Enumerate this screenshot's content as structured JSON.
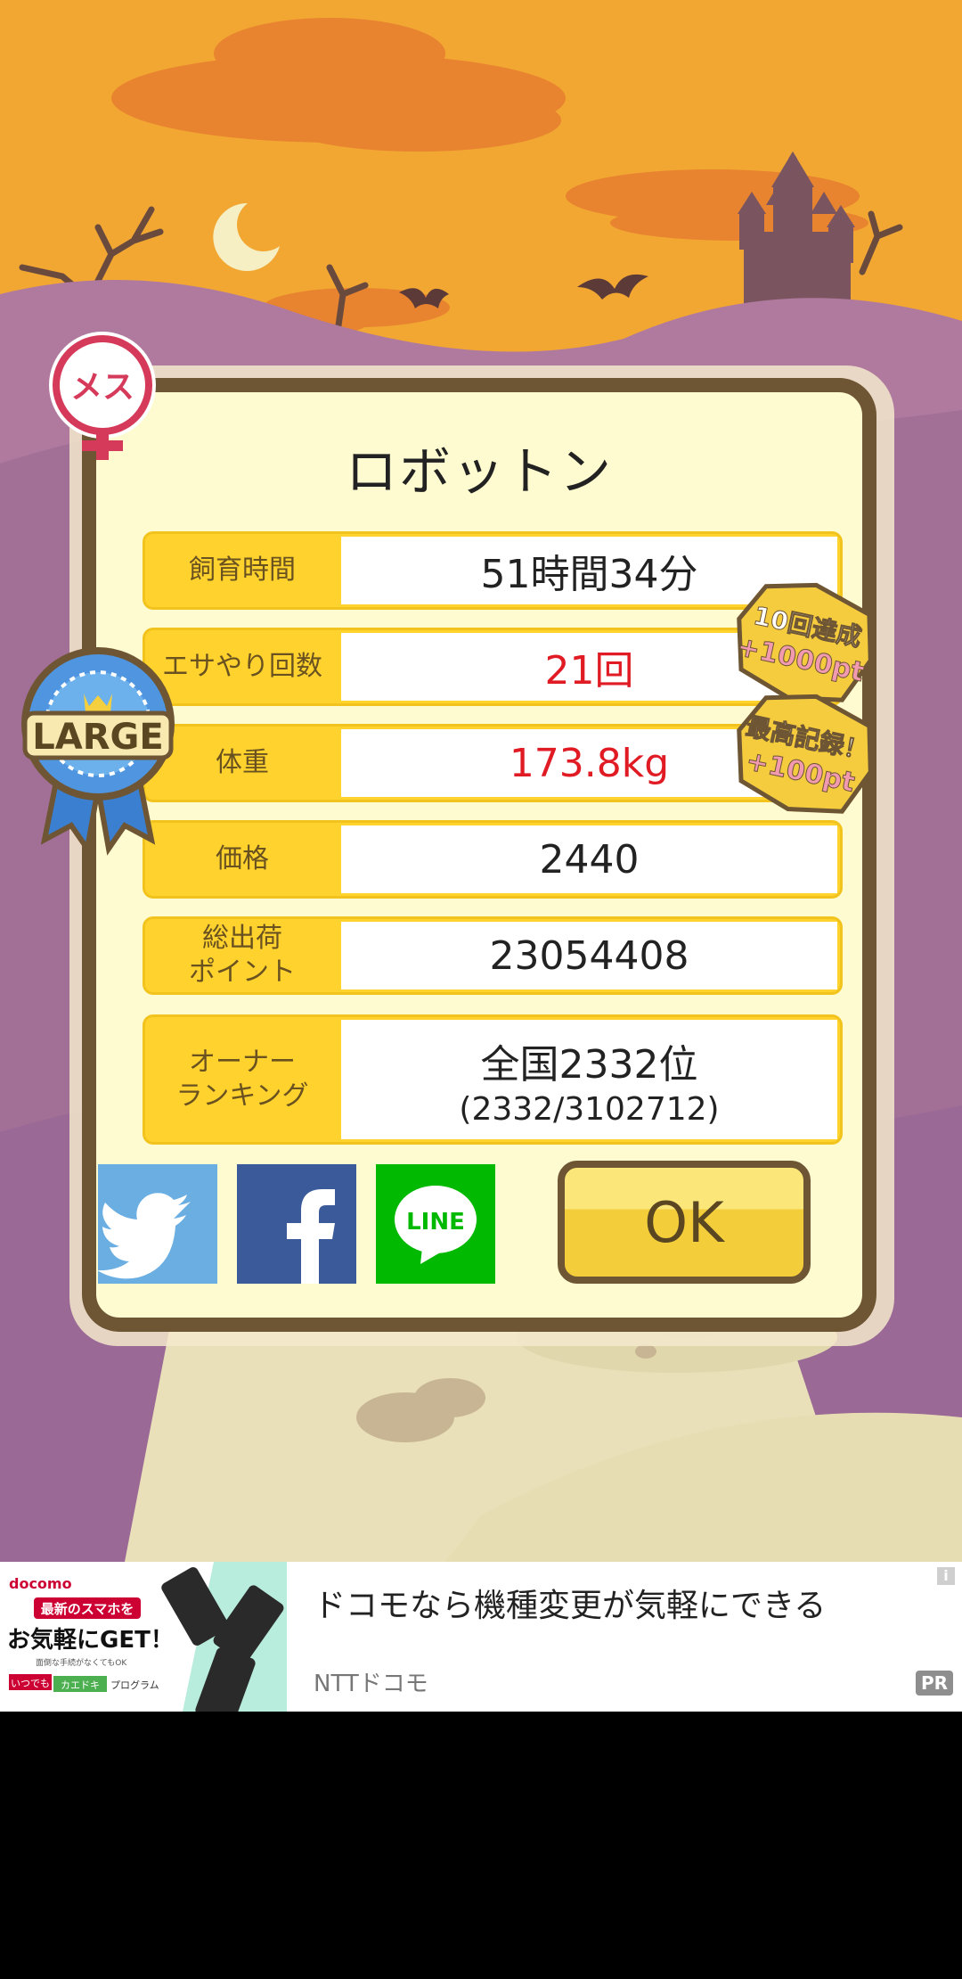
{
  "pet": {
    "name": "ロボットン",
    "gender_label": "メス",
    "size_badge": "LARGE"
  },
  "stats": [
    {
      "label": "飼育時間",
      "value": "51時間34分"
    },
    {
      "label": "エサやり回数",
      "value": "21回"
    },
    {
      "label": "体重",
      "value": "173.8kg"
    },
    {
      "label": "価格",
      "value": "2440"
    },
    {
      "label": "総出荷\nポイント",
      "value": "23054408"
    },
    {
      "label": "オーナー\nランキング",
      "value": "全国2332位",
      "subvalue": "(2332/3102712)"
    }
  ],
  "achievement_badges": [
    {
      "line1": "10回達成",
      "line2": "+1000pt"
    },
    {
      "line1": "最高記録！",
      "line2": "+100pt"
    }
  ],
  "share": {
    "line_label": "LINE"
  },
  "ok_label": "OK",
  "ad": {
    "title": "ドコモなら機種変更が気軽にできる",
    "advertiser": "NTTドコモ",
    "pr_badge": "PR",
    "info_icon": "i",
    "creative": {
      "brand": "docomo",
      "headline1": "最新のスマホを",
      "headline2": "お気軽にGET！",
      "note": "面倒な手続がなくてもOK",
      "program_prefix": "いつでも",
      "program_mid": "カエドキ",
      "program_suffix": "プログラム"
    }
  },
  "colors": {
    "sky": "#f2a733",
    "hills": "#9f6f9c",
    "panel_border": "#6e5533",
    "label_bg": "#ffd22e",
    "highlight_value": "#e01b24",
    "twitter": "#6aaee2",
    "facebook": "#3b5a9a",
    "line": "#00b900"
  }
}
